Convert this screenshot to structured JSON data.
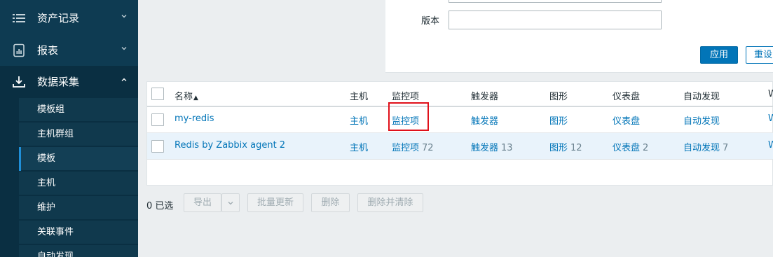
{
  "sidebar": {
    "menus": [
      {
        "label": "资产记录",
        "icon": "list-icon",
        "expanded": false
      },
      {
        "label": "报表",
        "icon": "report-icon",
        "expanded": false
      },
      {
        "label": "数据采集",
        "icon": "download-icon",
        "expanded": true
      }
    ],
    "submenu": [
      {
        "label": "模板组",
        "active": false
      },
      {
        "label": "主机群组",
        "active": false
      },
      {
        "label": "模板",
        "active": true
      },
      {
        "label": "主机",
        "active": false
      },
      {
        "label": "维护",
        "active": false
      },
      {
        "label": "关联事件",
        "active": false
      },
      {
        "label": "自动发现",
        "active": false
      }
    ]
  },
  "filter": {
    "version_label": "版本",
    "version_value": "",
    "apply_label": "应用",
    "reset_label": "重设"
  },
  "table": {
    "headers": {
      "name": "名称",
      "name_sort_arrow": "▲",
      "host": "主机",
      "items": "监控项",
      "triggers": "触发器",
      "graphs": "图形",
      "dashboards": "仪表盘",
      "discovery": "自动发现",
      "web": "W"
    },
    "rows": [
      {
        "name": "my-redis",
        "host": "主机",
        "items": "监控项",
        "items_count": "",
        "triggers": "触发器",
        "triggers_count": "",
        "graphs": "图形",
        "graphs_count": "",
        "dashboards": "仪表盘",
        "dashboards_count": "",
        "discovery": "自动发现",
        "discovery_count": "",
        "web": "W"
      },
      {
        "name": "Redis by Zabbix agent 2",
        "host": "主机",
        "items": "监控项",
        "items_count": "72",
        "triggers": "触发器",
        "triggers_count": "13",
        "graphs": "图形",
        "graphs_count": "12",
        "dashboards": "仪表盘",
        "dashboards_count": "2",
        "discovery": "自动发现",
        "discovery_count": "7",
        "web": "W"
      }
    ]
  },
  "actions": {
    "selected": "0 已选",
    "export": "导出",
    "mass_update": "批量更新",
    "delete": "删除",
    "delete_clear": "删除并清除"
  },
  "colors": {
    "sidebar_bg": "#0e3b52",
    "link": "#0275b8",
    "primary_button": "#0275b8",
    "highlight": "#e0101a"
  }
}
